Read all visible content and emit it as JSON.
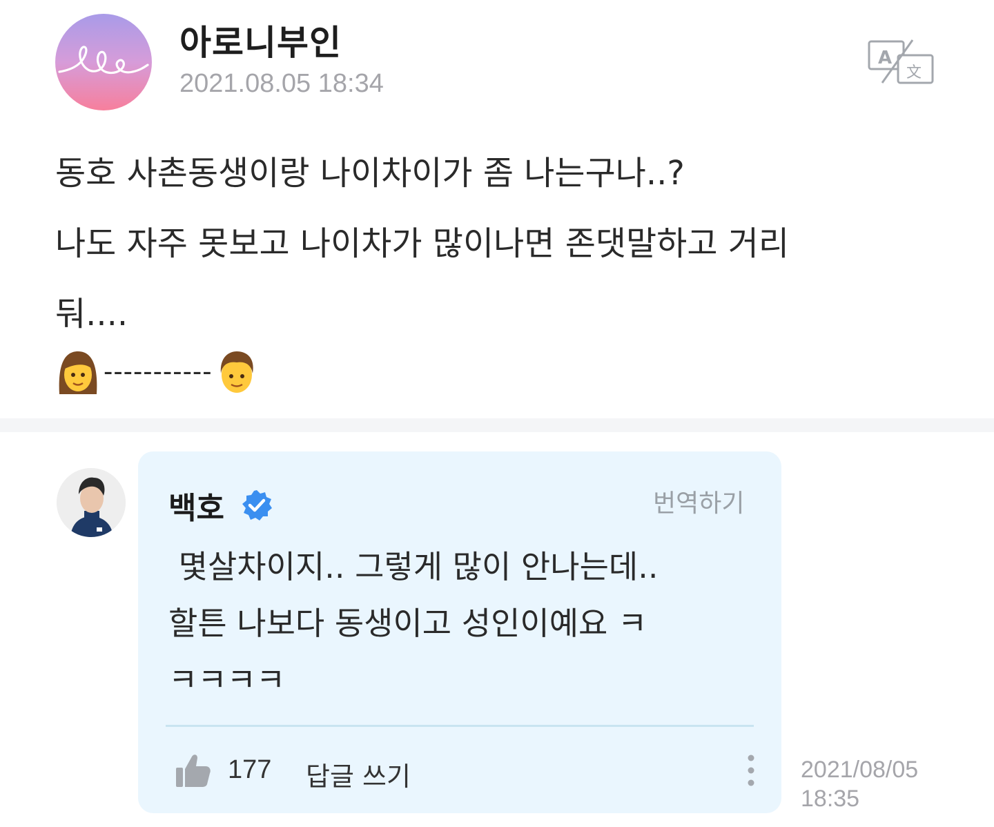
{
  "post": {
    "author": "아로니부인",
    "date": "2021.08.05 18:34",
    "body_lines": [
      "동호 사촌동생이랑 나이차이가 좀 나는구나..?",
      "나도 자주 못보고 나이차가 많이나면 존댓말하고 거리",
      "둬...."
    ],
    "emoji_line": {
      "left_emoji": "woman-emoji",
      "dashes": "-----------",
      "right_emoji": "man-emoji"
    },
    "translate_icon": "translate-icon",
    "avatar_brand_color": "#f77f9c"
  },
  "comment": {
    "author": "백호",
    "verified_icon": "verified-badge-icon",
    "verified_color": "#3b8ff0",
    "translate_label": "번역하기",
    "body_lines": [
      " 몇살차이지.. 그렇게 많이 안나는데..",
      "할튼 나보다 동생이고 성인이예요 ㅋ",
      "ㅋㅋㅋㅋ"
    ],
    "likes": "177",
    "reply_label": "답글 쓰기",
    "date_line1": "2021/08/05",
    "date_line2": "18:35",
    "card_color": "#eaf6fe"
  }
}
